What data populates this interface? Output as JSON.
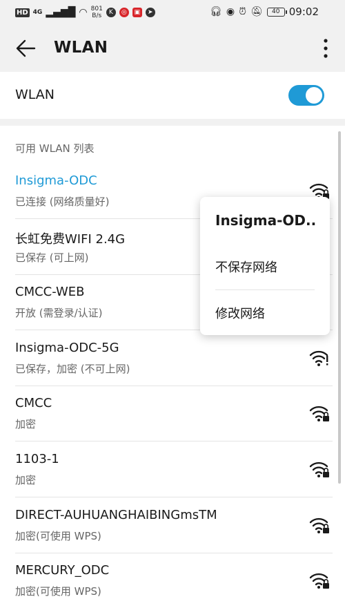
{
  "status_bar": {
    "hd_label": "HD",
    "network_label": "4G",
    "speed_top": "801",
    "speed_bottom": "B/s",
    "battery_level": "40",
    "time": "09:02"
  },
  "app_bar": {
    "title": "WLAN"
  },
  "wlan_toggle": {
    "label": "WLAN",
    "enabled": true,
    "accent_color": "#1f9ad6"
  },
  "section_header": "可用 WLAN 列表",
  "networks": [
    {
      "name": "Insigma-ODC",
      "status": "已连接 (网络质量好)",
      "connected": true,
      "locked": true
    },
    {
      "name": "长虹免费WIFI   2.4G",
      "status": "已保存 (可上网)",
      "connected": false,
      "locked": false
    },
    {
      "name": "CMCC-WEB",
      "status": "开放 (需登录/认证)",
      "connected": false,
      "locked": false
    },
    {
      "name": "Insigma-ODC-5G",
      "status": "已保存，加密 (不可上网)",
      "connected": false,
      "locked": false,
      "warning": true
    },
    {
      "name": "CMCC",
      "status": "加密",
      "connected": false,
      "locked": true
    },
    {
      "name": "1103-1",
      "status": "加密",
      "connected": false,
      "locked": true
    },
    {
      "name": "DIRECT-AUHUANGHAIBINGmsTM",
      "status": "加密(可使用 WPS)",
      "connected": false,
      "locked": true
    },
    {
      "name": "MERCURY_ODC",
      "status": "加密(可使用 WPS)",
      "connected": false,
      "locked": true
    }
  ],
  "popup_menu": {
    "title": "Insigma-OD..",
    "items": [
      "不保存网络",
      "修改网络"
    ]
  }
}
